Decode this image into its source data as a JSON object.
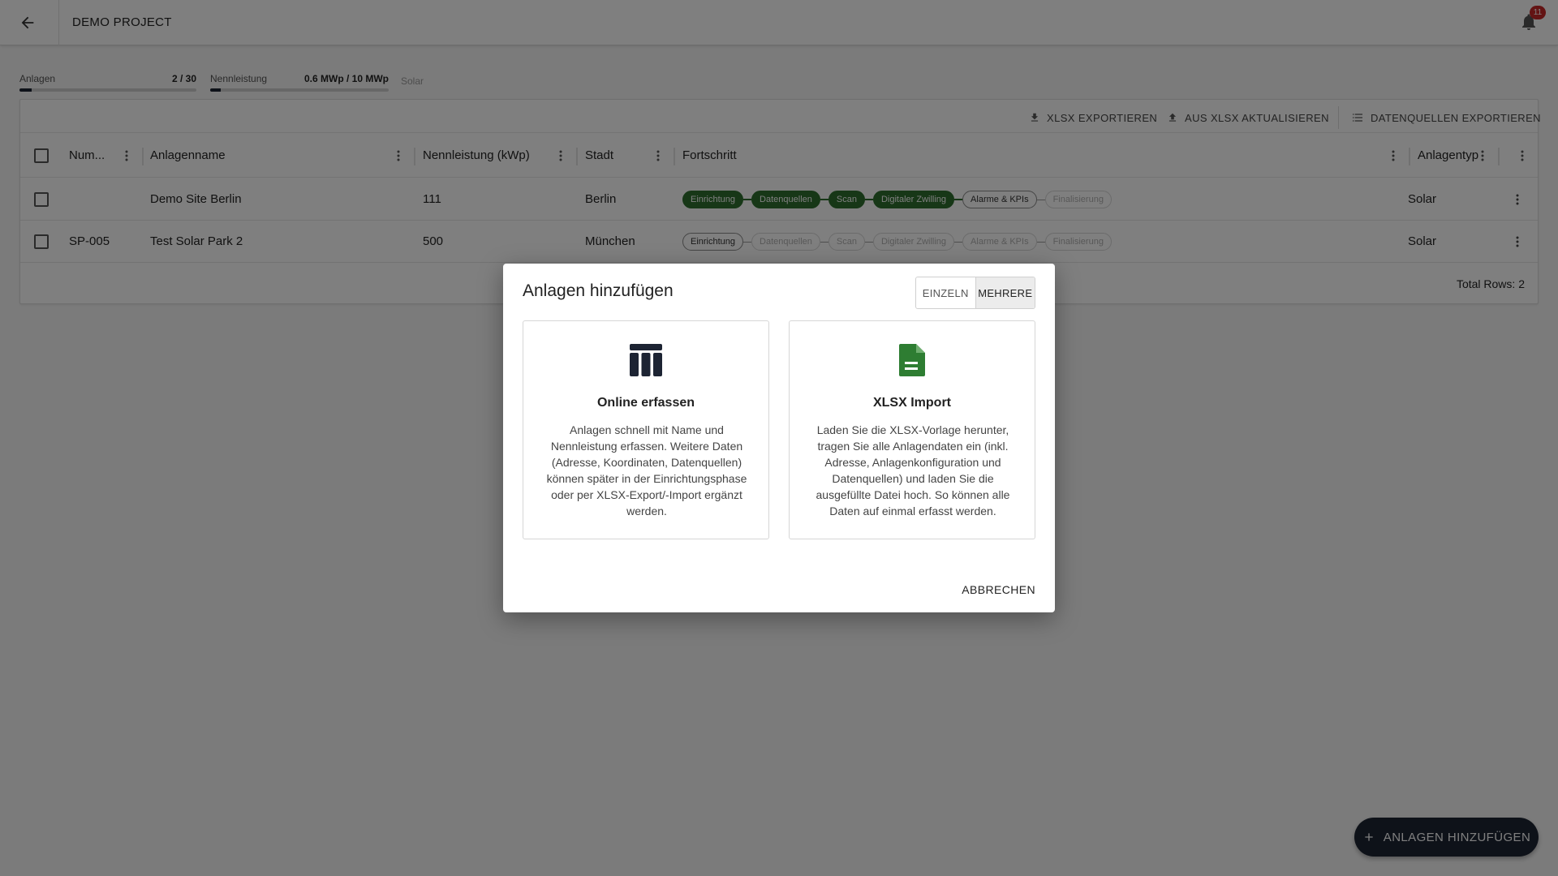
{
  "appbar": {
    "title": "DEMO PROJECT",
    "notifications_count": "11"
  },
  "stats": {
    "sites": {
      "label": "Anlagen",
      "value": "2 / 30",
      "fill": 0.067
    },
    "capacity": {
      "label": "Nennleistung",
      "value": "0.6 MWp / 10 MWp",
      "fill": 0.06
    },
    "type_label": "Solar"
  },
  "toolbar": {
    "export_xlsx": "XLSX EXPORTIEREN",
    "update_from_xlsx": "AUS XLSX AKTUALISIEREN",
    "export_datasources": "DATENQUELLEN EXPORTIEREN"
  },
  "table": {
    "columns": {
      "number": "Num...",
      "name": "Anlagenname",
      "capacity": "Nennleistung (kWp)",
      "city": "Stadt",
      "progress": "Fortschritt",
      "type": "Anlagentyp"
    },
    "rows": [
      {
        "number": "",
        "name": "Demo Site Berlin",
        "capacity": "111",
        "city": "Berlin",
        "type": "Solar",
        "steps": [
          {
            "label": "Einrichtung",
            "state": "done"
          },
          {
            "label": "Datenquellen",
            "state": "done"
          },
          {
            "label": "Scan",
            "state": "done"
          },
          {
            "label": "Digitaler Zwilling",
            "state": "done"
          },
          {
            "label": "Alarme & KPIs",
            "state": "active"
          },
          {
            "label": "Finalisierung",
            "state": "todo"
          }
        ]
      },
      {
        "number": "SP-005",
        "name": "Test Solar Park 2",
        "capacity": "500",
        "city": "München",
        "type": "Solar",
        "steps": [
          {
            "label": "Einrichtung",
            "state": "active"
          },
          {
            "label": "Datenquellen",
            "state": "todo"
          },
          {
            "label": "Scan",
            "state": "todo"
          },
          {
            "label": "Digitaler Zwilling",
            "state": "todo"
          },
          {
            "label": "Alarme & KPIs",
            "state": "todo"
          },
          {
            "label": "Finalisierung",
            "state": "todo"
          }
        ]
      }
    ],
    "total_rows": "Total Rows: 2"
  },
  "fab": {
    "label": "ANLAGEN HINZUFÜGEN"
  },
  "dialog": {
    "title": "Anlagen hinzufügen",
    "toggle_single": "EINZELN",
    "toggle_multiple": "MEHRERE",
    "online": {
      "title": "Online erfassen",
      "description": "Anlagen schnell mit Name und Nennleistung erfassen. Weitere Daten (Adresse, Koordinaten, Datenquellen) können später in der Einrichtungsphase oder per XLSX-Export/-Import ergänzt werden."
    },
    "xlsx": {
      "title": "XLSX Import",
      "description": "Laden Sie die XLSX-Vorlage herunter, tragen Sie alle Anlagendaten ein (inkl. Adresse, Anlagenkonfiguration und Datenquellen) und laden Sie die ausgefüllte Datei hoch. So können alle Daten auf einmal erfasst werden."
    },
    "cancel": "ABBRECHEN"
  },
  "colors": {
    "done_green": "#2e6e2e",
    "fab_navy": "#1d2433",
    "xlsx_icon_green": "#2e7d32",
    "table_icon_navy": "#1d2433"
  }
}
